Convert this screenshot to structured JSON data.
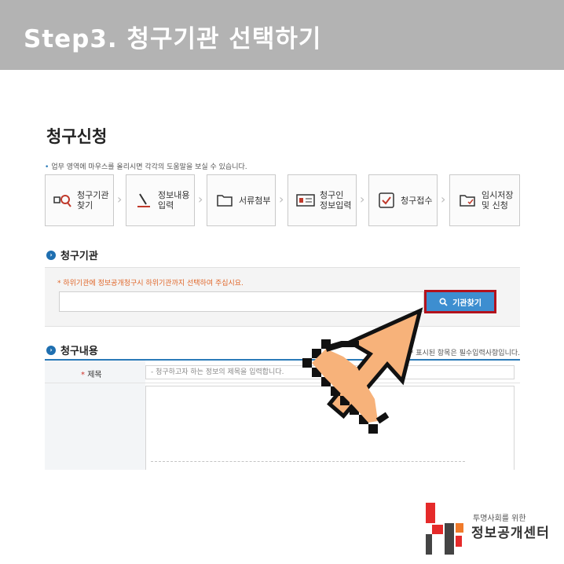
{
  "banner": {
    "title": "Step3. 청구기관 선택하기"
  },
  "page": {
    "title": "청구신청",
    "hint": "업무 영역에 마우스를 올리시면 각각의 도움말을 보실 수 있습니다."
  },
  "steps": [
    {
      "label": "청구기관\n찾기",
      "icon": "search-org-icon"
    },
    {
      "label": "정보내용\n입력",
      "icon": "pen-icon"
    },
    {
      "label": "서류첨부",
      "icon": "folder-icon"
    },
    {
      "label": "청구인\n정보입력",
      "icon": "id-card-icon"
    },
    {
      "label": "청구접수",
      "icon": "check-box-icon"
    },
    {
      "label": "임시저장\n및 신청",
      "icon": "save-folder-icon"
    }
  ],
  "org_section": {
    "heading": "청구기관",
    "note": "* 하위기관에 정보공개청구시 하위기관까지 선택하여 주십시요.",
    "input_value": "",
    "find_button": "기관찾기"
  },
  "content_section": {
    "heading": "청구내용",
    "required_note": "* 표시된 항목은 필수입력사항입니다.",
    "title_label": "제목",
    "title_placeholder": "- 청구하고자 하는 정보의 제목을 입력합니다."
  },
  "logo": {
    "sub": "투명사회를 위한",
    "main": "정보공개센터"
  },
  "colors": {
    "banner": "#b3b3b3",
    "accent_blue": "#3d8ed0",
    "highlight_red": "#b3121d",
    "note_orange": "#e0672a",
    "cursor_fill": "#f7b27a"
  }
}
